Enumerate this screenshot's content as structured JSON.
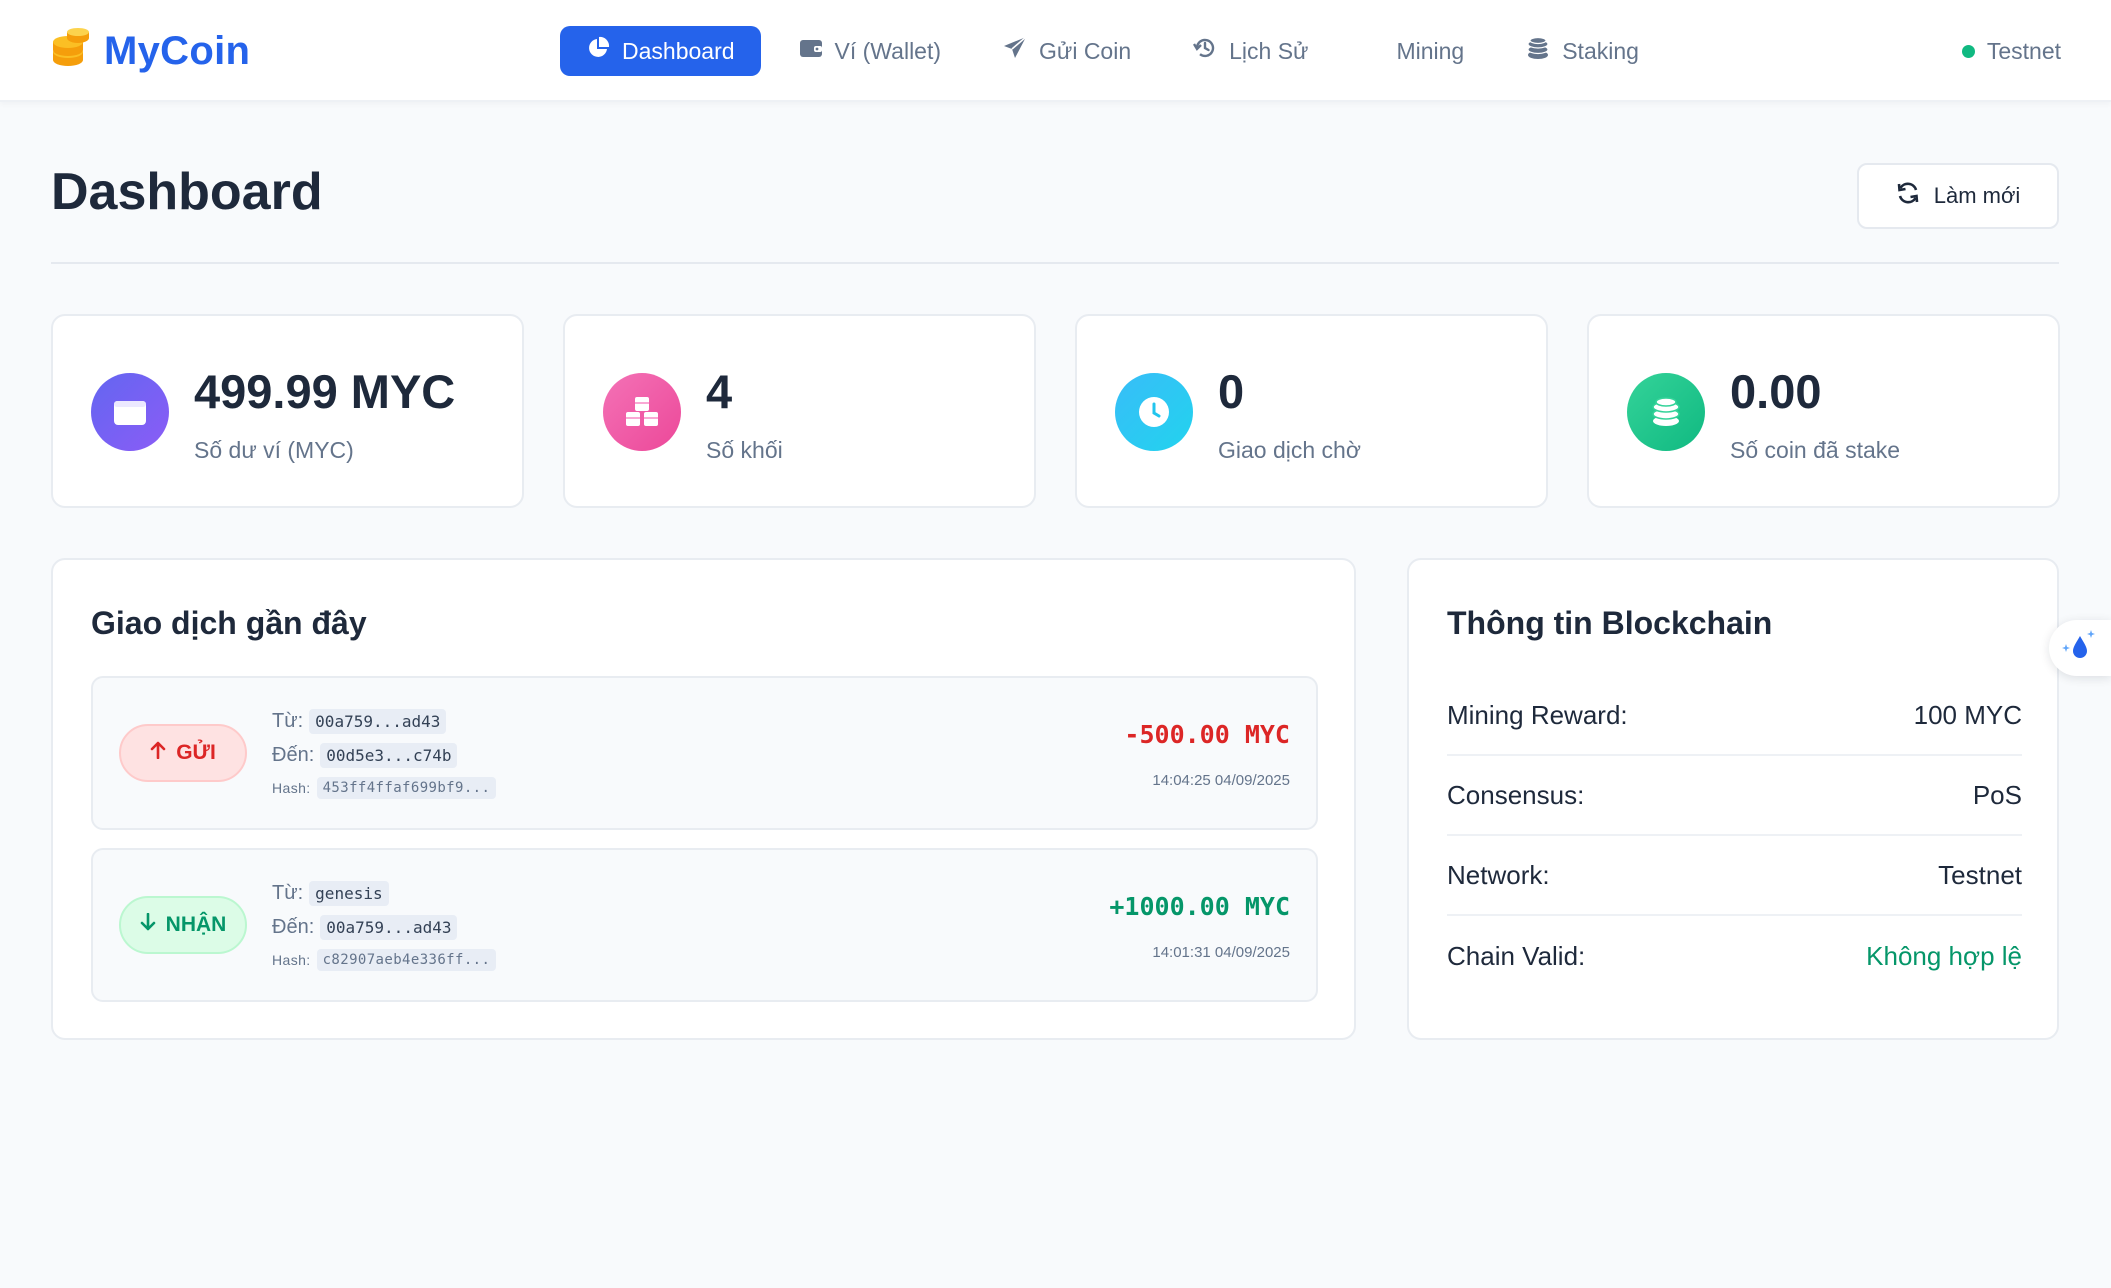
{
  "brand": {
    "name": "MyCoin",
    "logo_icon": "coins-icon",
    "logo_color": "#f59e0b"
  },
  "nav": {
    "items": [
      {
        "label": "Dashboard",
        "icon": "chart-pie-icon",
        "active": true
      },
      {
        "label": "Ví (Wallet)",
        "icon": "wallet-icon"
      },
      {
        "label": "Gửi Coin",
        "icon": "paper-plane-icon"
      },
      {
        "label": "Lịch Sử",
        "icon": "history-icon"
      },
      {
        "label": "Mining",
        "icon": ""
      },
      {
        "label": "Staking",
        "icon": "coins-icon"
      }
    ],
    "network": "Testnet",
    "network_status_color": "#10b981",
    "accent_color": "#2563eb"
  },
  "page": {
    "title": "Dashboard",
    "refresh_label": "Làm mới"
  },
  "stats": [
    {
      "value": "499.99 MYC",
      "label": "Số dư ví (MYC)",
      "icon": "wallet-icon",
      "color": "#6d5dd3"
    },
    {
      "value": "4",
      "label": "Số khối",
      "icon": "cubes-icon",
      "color": "#ec4899"
    },
    {
      "value": "0",
      "label": "Giao dịch chờ",
      "icon": "clock-icon",
      "color": "#22c5ee"
    },
    {
      "value": "0.00",
      "label": "Số coin đã stake",
      "icon": "coins-icon",
      "color": "#34d399"
    }
  ],
  "transactions": {
    "title": "Giao dịch gần đây",
    "from_label": "Từ:",
    "to_label": "Đến:",
    "hash_label": "Hash:",
    "items": [
      {
        "type": "GỬI",
        "direction": "send",
        "from": "00a759...ad43",
        "to": "00d5e3...c74b",
        "hash": "453ff4ffaf699bf9...",
        "amount": "-500.00 MYC",
        "time": "14:04:25 04/09/2025"
      },
      {
        "type": "NHẬN",
        "direction": "receive",
        "from": "genesis",
        "to": "00a759...ad43",
        "hash": "c82907aeb4e336ff...",
        "amount": "+1000.00 MYC",
        "time": "14:01:31 04/09/2025"
      }
    ]
  },
  "blockchain_info": {
    "title": "Thông tin Blockchain",
    "rows": [
      {
        "label": "Mining Reward:",
        "value": "100 MYC"
      },
      {
        "label": "Consensus:",
        "value": "PoS"
      },
      {
        "label": "Network:",
        "value": "Testnet"
      },
      {
        "label": "Chain Valid:",
        "value": "Không hợp lệ",
        "value_color": "#059669"
      }
    ]
  },
  "floating_widget": {
    "icon": "droplet-sparkle-icon"
  }
}
